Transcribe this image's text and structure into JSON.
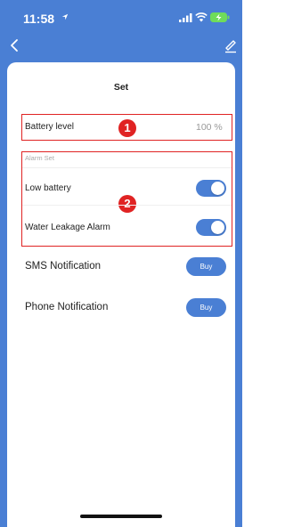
{
  "status_bar": {
    "time": "11:58"
  },
  "nav": {
    "back_icon": "chevron-left",
    "edit_icon": "pencil"
  },
  "page": {
    "title": "Set"
  },
  "battery": {
    "label": "Battery level",
    "value": "100 %"
  },
  "alarm_set": {
    "section_label": "Alarm Set",
    "items": [
      {
        "label": "Low battery",
        "enabled": true
      },
      {
        "label": "Water Leakage Alarm",
        "enabled": true
      }
    ]
  },
  "notifications": [
    {
      "label": "SMS Notification",
      "button": "Buy"
    },
    {
      "label": "Phone Notification",
      "button": "Buy"
    }
  ],
  "markers": [
    "1",
    "2"
  ],
  "colors": {
    "accent": "#4a7fd4",
    "highlight": "#e02323"
  }
}
